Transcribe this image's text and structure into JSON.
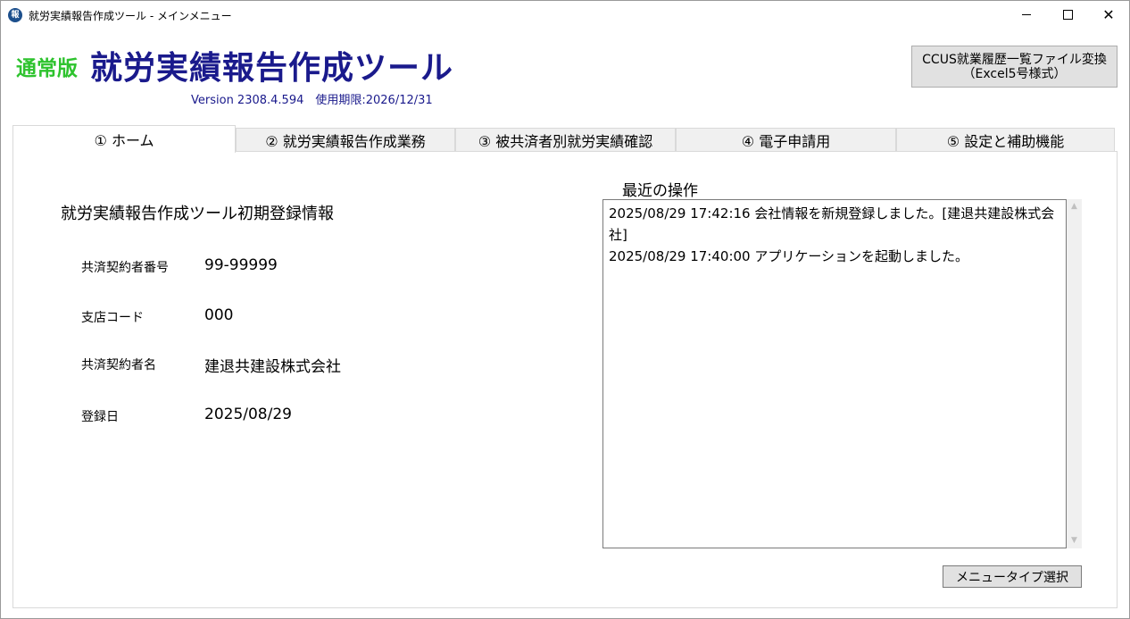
{
  "window": {
    "title": "就労実績報告作成ツール - メインメニュー",
    "icon_glyph": "報",
    "close_glyph": "✕"
  },
  "header": {
    "edition": "通常版",
    "app_title": "就労実績報告作成ツール",
    "version": "Version 2308.4.594　使用期限:2026/12/31",
    "ccus_button_line1": "CCUS就業履歴一覧ファイル変換",
    "ccus_button_line2": "（Excel5号様式）"
  },
  "tabs": [
    {
      "label": "① ホーム"
    },
    {
      "label": "② 就労実績報告作成業務"
    },
    {
      "label": "③ 被共済者別就労実績確認"
    },
    {
      "label": "④ 電子申請用"
    },
    {
      "label": "⑤ 設定と補助機能"
    }
  ],
  "home": {
    "section_title": "就労実績報告作成ツール初期登録情報",
    "fields": [
      {
        "label": "共済契約者番号",
        "value": "99-99999"
      },
      {
        "label": "支店コード",
        "value": "000"
      },
      {
        "label": "共済契約者名",
        "value": "建退共建設株式会社"
      },
      {
        "label": "登録日",
        "value": "2025/08/29"
      }
    ],
    "recent_title": "最近の操作",
    "log": [
      "2025/08/29 17:42:16 会社情報を新規登録しました。[建退共建設株式会社]",
      "2025/08/29 17:40:00 アプリケーションを起動しました。"
    ],
    "menu_type_button": "メニュータイプ選択"
  },
  "colors": {
    "edition": "#2ec32e",
    "title": "#1a1a8c",
    "button_bg": "#e1e1e1",
    "tab_bg": "#f0f0f0"
  }
}
